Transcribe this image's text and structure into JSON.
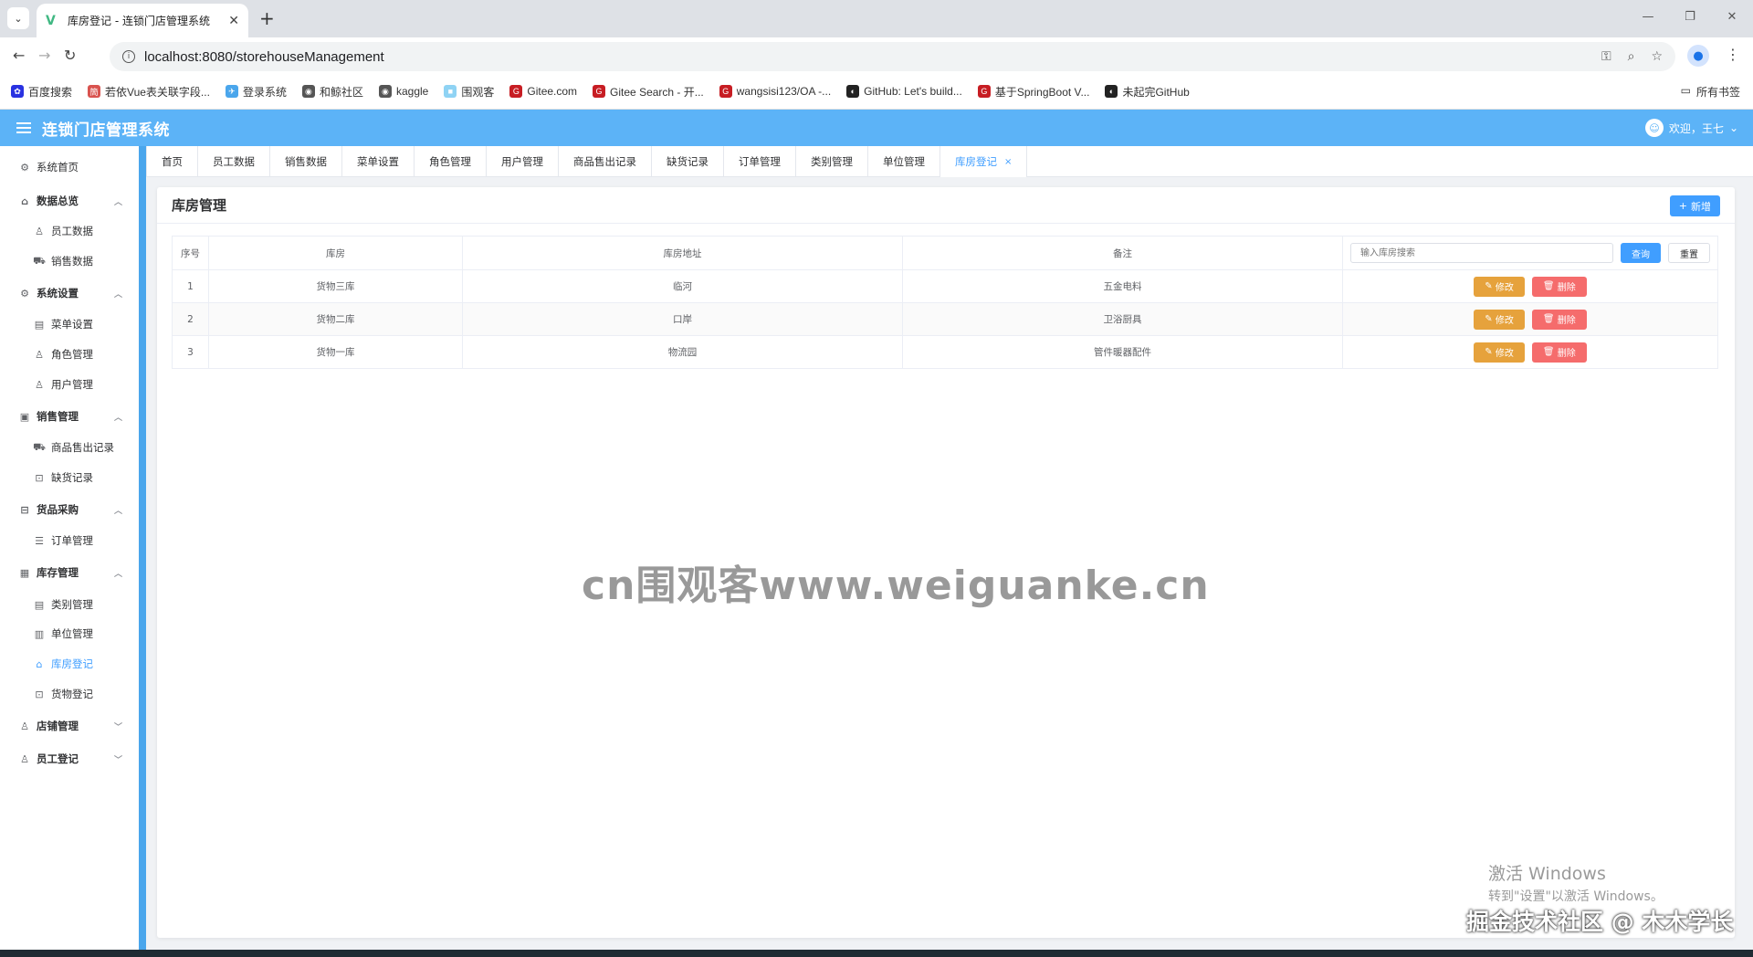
{
  "browser": {
    "tab_title": "库房登记 - 连锁门店管理系统",
    "url": "localhost:8080/storehouseManagement",
    "bookmarks": [
      {
        "label": "百度搜索",
        "color": "#2932e1",
        "icon": "paw-icon"
      },
      {
        "label": "若依Vue表关联字段...",
        "color": "#d9534f",
        "icon": "doc-icon"
      },
      {
        "label": "登录系统",
        "color": "#4aa6ec",
        "icon": "plane-icon"
      },
      {
        "label": "和鲸社区",
        "color": "#555555",
        "icon": "globe-icon"
      },
      {
        "label": "kaggle",
        "color": "#555555",
        "icon": "globe-icon"
      },
      {
        "label": "围观客",
        "color": "#8fd3f4",
        "icon": "square-icon"
      },
      {
        "label": "Gitee.com",
        "color": "#c71d23",
        "icon": "gitee-icon"
      },
      {
        "label": "Gitee Search - 开...",
        "color": "#c71d23",
        "icon": "gitee-icon"
      },
      {
        "label": "wangsisi123/OA -...",
        "color": "#c71d23",
        "icon": "gitee-icon"
      },
      {
        "label": "GitHub: Let's build...",
        "color": "#222222",
        "icon": "github-icon"
      },
      {
        "label": "基于SpringBoot V...",
        "color": "#c71d23",
        "icon": "gitee-icon"
      },
      {
        "label": "未起完GitHub",
        "color": "#222222",
        "icon": "github-icon"
      }
    ],
    "all_bookmarks": "所有书签"
  },
  "app": {
    "title": "连锁门店管理系统",
    "welcome": "欢迎，王七"
  },
  "sidebar": {
    "items": [
      {
        "label": "系统首页",
        "type": "top",
        "icon": "gear-icon"
      },
      {
        "label": "数据总览",
        "type": "group",
        "icon": "home-icon",
        "caret": "up"
      },
      {
        "label": "员工数据",
        "type": "sub",
        "icon": "user-icon"
      },
      {
        "label": "销售数据",
        "type": "sub",
        "icon": "truck-icon"
      },
      {
        "label": "系统设置",
        "type": "group",
        "icon": "gear-icon",
        "caret": "up"
      },
      {
        "label": "菜单设置",
        "type": "sub",
        "icon": "doc-icon"
      },
      {
        "label": "角色管理",
        "type": "sub",
        "icon": "user-icon"
      },
      {
        "label": "用户管理",
        "type": "sub",
        "icon": "user-icon"
      },
      {
        "label": "销售管理",
        "type": "group",
        "icon": "chart-icon",
        "caret": "up"
      },
      {
        "label": "商品售出记录",
        "type": "sub",
        "icon": "truck-icon"
      },
      {
        "label": "缺货记录",
        "type": "sub",
        "icon": "bag-icon"
      },
      {
        "label": "货品采购",
        "type": "group",
        "icon": "lock-icon",
        "caret": "up"
      },
      {
        "label": "订单管理",
        "type": "sub",
        "icon": "list-icon"
      },
      {
        "label": "库存管理",
        "type": "group",
        "icon": "box-icon",
        "caret": "up"
      },
      {
        "label": "类别管理",
        "type": "sub",
        "icon": "doc-icon"
      },
      {
        "label": "单位管理",
        "type": "sub",
        "icon": "building-icon"
      },
      {
        "label": "库房登记",
        "type": "sub",
        "icon": "house-icon",
        "active": true
      },
      {
        "label": "货物登记",
        "type": "sub",
        "icon": "bag-icon"
      },
      {
        "label": "店铺管理",
        "type": "group",
        "icon": "user-icon",
        "caret": "down"
      },
      {
        "label": "员工登记",
        "type": "group",
        "icon": "user-icon",
        "caret": "down"
      }
    ]
  },
  "tags": [
    {
      "label": "首页"
    },
    {
      "label": "员工数据"
    },
    {
      "label": "销售数据"
    },
    {
      "label": "菜单设置"
    },
    {
      "label": "角色管理"
    },
    {
      "label": "用户管理"
    },
    {
      "label": "商品售出记录"
    },
    {
      "label": "缺货记录"
    },
    {
      "label": "订单管理"
    },
    {
      "label": "类别管理"
    },
    {
      "label": "单位管理"
    },
    {
      "label": "库房登记",
      "active": true
    }
  ],
  "page": {
    "title": "库房管理",
    "add_label": "新增",
    "search_placeholder": "输入库房搜索",
    "search_label": "查询",
    "reset_label": "重置",
    "columns": [
      "序号",
      "库房",
      "库房地址",
      "备注"
    ],
    "edit_label": "修改",
    "delete_label": "删除",
    "rows": [
      {
        "idx": "1",
        "name": "货物三库",
        "address": "临河",
        "note": "五金电料"
      },
      {
        "idx": "2",
        "name": "货物二库",
        "address": "口岸",
        "note": "卫浴厨具"
      },
      {
        "idx": "3",
        "name": "货物一库",
        "address": "物流园",
        "note": "管件暖器配件"
      }
    ]
  },
  "overlays": {
    "watermark": "cn围观客www.weiguanke.cn",
    "activate_title": "激活 Windows",
    "activate_sub": "转到\"设置\"以激活 Windows。",
    "site_mark": "掘金技术社区 @ 木木学长"
  }
}
